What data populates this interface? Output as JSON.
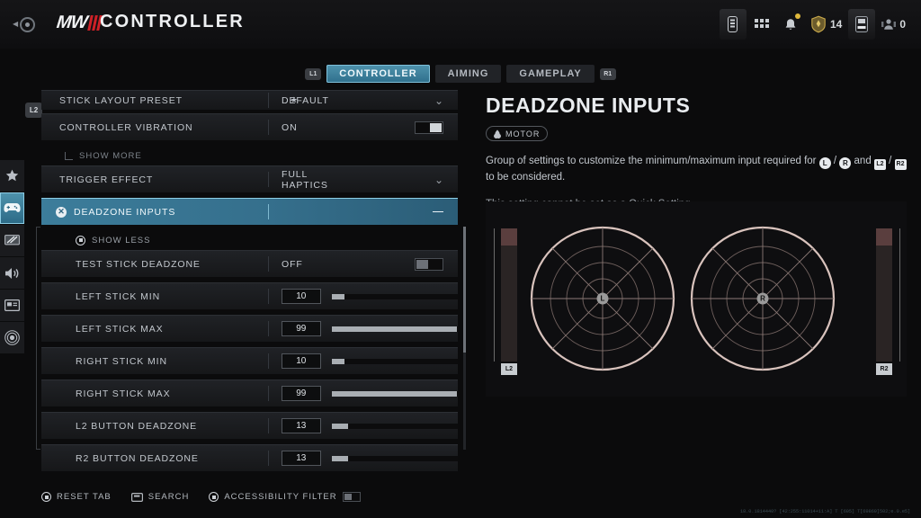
{
  "header": {
    "back_icon": "back-circle-icon",
    "logo_text": "MW",
    "title": "CONTROLLER",
    "icons": [
      {
        "name": "battery-icon",
        "label": ""
      },
      {
        "name": "grid-apps-icon",
        "label": ""
      },
      {
        "name": "bell-notification-icon",
        "label": ""
      },
      {
        "name": "battlepass-token-icon",
        "label": "14"
      },
      {
        "name": "keycard-icon",
        "label": ""
      },
      {
        "name": "party-members-icon",
        "label": "0"
      }
    ]
  },
  "tabs": {
    "left_bumper": "L1",
    "right_bumper": "R1",
    "items": [
      {
        "label": "CONTROLLER",
        "active": true
      },
      {
        "label": "AIMING",
        "active": false
      },
      {
        "label": "GAMEPLAY",
        "active": false
      }
    ]
  },
  "rail": {
    "items": [
      {
        "name": "favorites-star-icon",
        "active": false
      },
      {
        "name": "controller-gamepad-icon",
        "active": true
      },
      {
        "name": "graphics-display-icon",
        "active": false
      },
      {
        "name": "audio-speaker-icon",
        "active": false
      },
      {
        "name": "account-card-icon",
        "active": false
      },
      {
        "name": "network-radar-icon",
        "active": false
      }
    ],
    "badge": "L2"
  },
  "settings": {
    "rows": [
      {
        "label": "STICK LAYOUT PRESET",
        "value": "DEFAULT",
        "control": "dropdown",
        "star": true,
        "partial": true
      },
      {
        "label": "CONTROLLER VIBRATION",
        "value": "ON",
        "control": "toggle",
        "toggle_state": "on"
      },
      {
        "label": "SHOW MORE",
        "control": "showmore"
      },
      {
        "label": "TRIGGER EFFECT",
        "value": "FULL HAPTICS",
        "control": "dropdown"
      },
      {
        "label": "DEADZONE INPUTS",
        "control": "group-header",
        "selected": true,
        "collapse_glyph": "minus"
      },
      {
        "label": "SHOW LESS",
        "control": "showless"
      },
      {
        "label": "TEST STICK DEADZONE",
        "value": "OFF",
        "control": "toggle",
        "toggle_state": "off",
        "sub": true
      },
      {
        "label": "LEFT STICK MIN",
        "value": "10",
        "control": "slider",
        "fill": 10,
        "sub": true
      },
      {
        "label": "LEFT STICK MAX",
        "value": "99",
        "control": "slider",
        "fill": 99,
        "sub": true
      },
      {
        "label": "RIGHT STICK MIN",
        "value": "10",
        "control": "slider",
        "fill": 10,
        "sub": true
      },
      {
        "label": "RIGHT STICK MAX",
        "value": "99",
        "control": "slider",
        "fill": 99,
        "sub": true
      },
      {
        "label": "L2 BUTTON DEADZONE",
        "value": "13",
        "control": "slider",
        "fill": 13,
        "sub": true
      },
      {
        "label": "R2 BUTTON DEADZONE",
        "value": "13",
        "control": "slider",
        "fill": 13,
        "sub": true
      }
    ]
  },
  "detail": {
    "title": "DEADZONE INPUTS",
    "tag": "MOTOR",
    "tag_icon": "motor-vibration-icon",
    "desc_part1": "Group of settings to customize the minimum/maximum input required for",
    "glyph_l": "L",
    "desc_sep1": "/",
    "glyph_r": "R",
    "desc_part2": "and",
    "glyph_l2": "L2",
    "desc_sep2": "/",
    "glyph_r2": "R2",
    "desc_part3": "to be considered.",
    "note": "This setting cannot be set as a Quick Setting.",
    "viz": {
      "left_stick_label": "L",
      "right_stick_label": "R",
      "l2_cap": "L2",
      "r2_cap": "R2"
    }
  },
  "footer": {
    "items": [
      {
        "name": "reset-tab-button",
        "label": "RESET TAB",
        "glyph": "button-round"
      },
      {
        "name": "search-button",
        "label": "SEARCH",
        "glyph": "touchpad"
      },
      {
        "name": "accessibility-filter-toggle",
        "label": "ACCESSIBILITY FILTER",
        "glyph": "triangle"
      }
    ],
    "build": "18.0.1814440? [42:255:11014+11:A] T [605] T[69869]502;e.0.e5]"
  }
}
